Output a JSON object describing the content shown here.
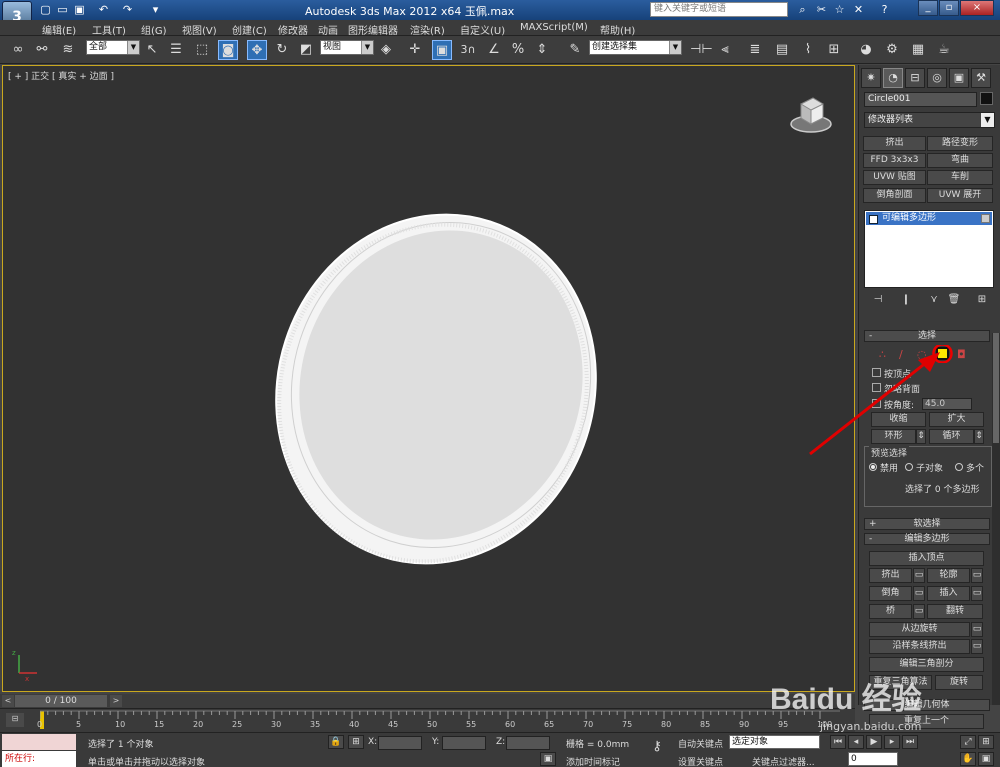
{
  "titlebar": {
    "logo": "3",
    "title": "Autodesk 3ds Max  2012 x64      玉佩.max",
    "search_placeholder": "键入关键字或短语",
    "buttons": [
      "⌕",
      "✂",
      "☆",
      "✕",
      "?"
    ],
    "window": [
      "_",
      "▫",
      "×"
    ]
  },
  "menu": [
    "编辑(E)",
    "工具(T)",
    "组(G)",
    "视图(V)",
    "创建(C)",
    "修改器",
    "动画",
    "图形编辑器",
    "渲染(R)",
    "自定义(U)",
    "MAXScript(M)",
    "帮助(H)"
  ],
  "toolbar": {
    "selection_filter": "全部",
    "ref_coord": "视图",
    "named_selection": "创建选择集",
    "snap_3": "3"
  },
  "viewport": {
    "label": "[ + ] 正交 [ 真实 + 边面 ]"
  },
  "cmdpanel": {
    "object_name": "Circle001",
    "modifier_list": "修改器列表",
    "mod_buttons": [
      "挤出",
      "路径变形",
      "FFD 3x3x3",
      "弯曲",
      "UVW 贴图",
      "车削",
      "倒角剖面",
      "UVW 展开"
    ],
    "stack_item": "可编辑多边形",
    "selection": {
      "header": "选择",
      "by_vertex": "按顶点",
      "ignore_backfacing": "忽略背面",
      "by_angle": "按角度:",
      "angle_value": "45.0",
      "shrink": "收缩",
      "grow": "扩大",
      "ring": "环形",
      "loop": "循环",
      "preview_title": "预览选择",
      "disable": "禁用",
      "subobject": "子对象",
      "multi": "多个",
      "status": "选择了 0 个多边形"
    },
    "soft_selection": "软选择",
    "edit_polygons": {
      "header": "编辑多边形",
      "insert_vertex": "插入顶点",
      "extrude": "挤出",
      "outline": "轮廓",
      "bevel": "倒角",
      "inset": "插入",
      "bridge": "桥",
      "flip": "翻转",
      "hinge": "从边旋转",
      "extrude_spline": "沿样条线挤出",
      "edit_tri": "编辑三角剖分",
      "retriangulate": "重复三角算法",
      "turn": "旋转"
    },
    "extra": [
      "编辑几何体",
      "重复上一个"
    ]
  },
  "timeline": {
    "frame": "0 / 100",
    "ticks": [
      "0",
      "5",
      "10",
      "15",
      "20",
      "25",
      "30",
      "35",
      "40",
      "45",
      "50",
      "55",
      "60",
      "65",
      "70",
      "75",
      "80",
      "85",
      "90",
      "95",
      "100"
    ]
  },
  "status": {
    "listener": "所在行:",
    "selected": "选择了 1 个对象",
    "prompt": "单击或单击并拖动以选择对象",
    "x_label": "X:",
    "y_label": "Y:",
    "z_label": "Z:",
    "grid": "栅格 = 0.0mm",
    "add_time_tag": "添加时间标记",
    "auto_key": "自动关键点",
    "selected_obj": "选定对象",
    "set_key": "设置关键点",
    "key_filters": "关键点过滤器...",
    "frame_value": "0"
  },
  "watermark": "Baidu 经验",
  "watermark_url": "jingyan.baidu.com",
  "colors": {
    "highlight": "#ffe600",
    "annotation": "#e00000",
    "selection_blue": "#3a73c5"
  }
}
